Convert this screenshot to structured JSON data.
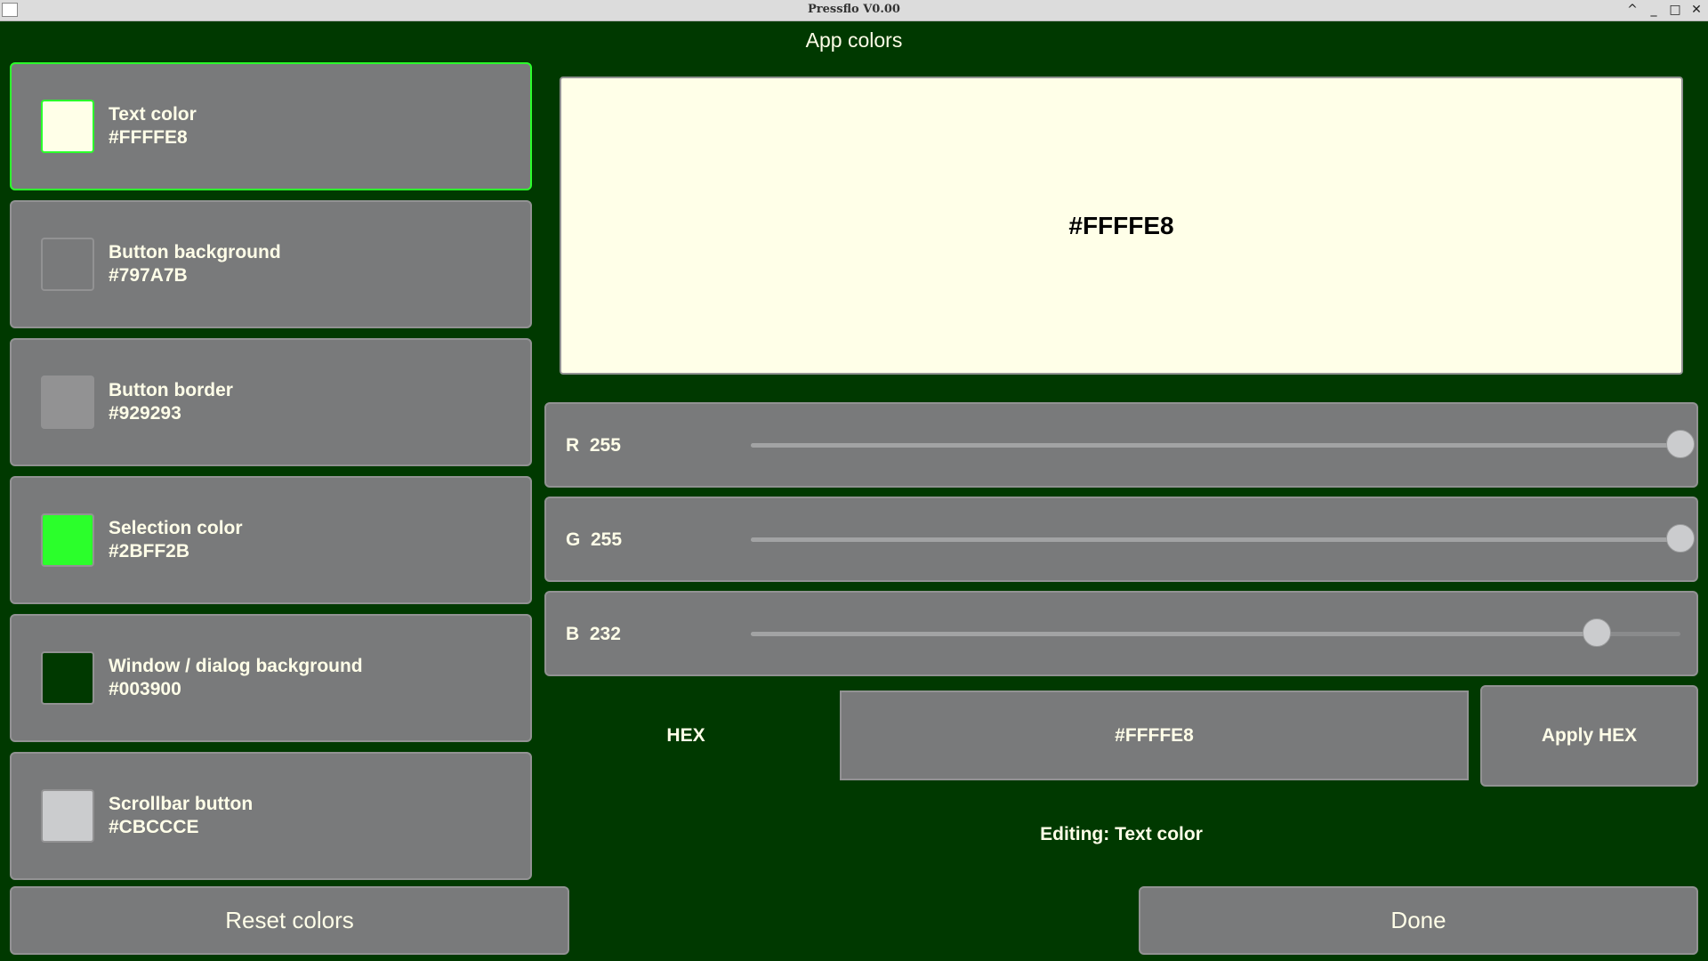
{
  "window": {
    "title": "Pressflo V0.00",
    "controls": {
      "collapse": "^",
      "minimize": "_",
      "maximize": "□",
      "close": "✕"
    }
  },
  "heading": "App colors",
  "color_items": [
    {
      "name": "Text color",
      "hex": "#FFFFE8",
      "swatch": "#FFFFE8",
      "selected": true
    },
    {
      "name": "Button background",
      "hex": "#797A7B",
      "swatch": "#797A7B",
      "selected": false
    },
    {
      "name": "Button border",
      "hex": "#929293",
      "swatch": "#929293",
      "selected": false
    },
    {
      "name": "Selection color",
      "hex": "#2BFF2B",
      "swatch": "#2BFF2B",
      "selected": false
    },
    {
      "name": "Window / dialog background",
      "hex": "#003900",
      "swatch": "#003900",
      "selected": false
    },
    {
      "name": "Scrollbar button",
      "hex": "#CBCCCE",
      "swatch": "#CBCCCE",
      "selected": false
    }
  ],
  "preview": {
    "text": "#FFFFE8",
    "color": "#FFFFE8"
  },
  "sliders": [
    {
      "label": "R  255",
      "channel": "R",
      "value": 255,
      "max": 255
    },
    {
      "label": "G  255",
      "channel": "G",
      "value": 255,
      "max": 255
    },
    {
      "label": "B  232",
      "channel": "B",
      "value": 232,
      "max": 255
    }
  ],
  "hex": {
    "label": "HEX",
    "value": "#FFFFE8",
    "apply_label": "Apply HEX"
  },
  "editing_status": "Editing: Text color",
  "buttons": {
    "reset_label": "Reset colors",
    "done_label": "Done"
  },
  "colors": {
    "window_bg": "#003900",
    "button_bg": "#797A7B",
    "button_border": "#929293",
    "selection": "#2BFF2B",
    "text": "#FFFFE8",
    "scrollbar_button": "#CBCCCE"
  }
}
